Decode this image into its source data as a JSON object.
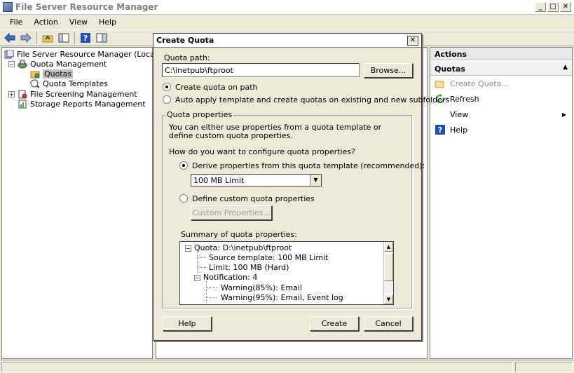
{
  "window": {
    "title": "File Server Resource Manager"
  },
  "menu": [
    "File",
    "Action",
    "View",
    "Help"
  ],
  "tree": {
    "root": "File Server Resource Manager (Local)",
    "quota_management": "Quota Management",
    "quotas": "Quotas",
    "quota_templates": "Quota Templates",
    "file_screening": "File Screening Management",
    "storage_reports": "Storage Reports Management"
  },
  "actions": {
    "header": "Actions",
    "section": "Quotas",
    "items": [
      "Create Quota...",
      "Refresh",
      "View",
      "Help"
    ]
  },
  "dialog": {
    "title": "Create Quota",
    "quota_path_label": "Quota path:",
    "quota_path_value": "C:\\inetpub\\ftproot",
    "browse": "Browse...",
    "opt_create": "Create quota on path",
    "opt_auto": "Auto apply template and create quotas on existing and new subfolders",
    "group_label": "Quota properties",
    "desc": "You can either use properties from a quota template or define custom quota properties.",
    "question": "How do you want to configure quota properties?",
    "opt_derive": "Derive properties from this quota template (recommended):",
    "template_value": "100 MB Limit",
    "opt_custom": "Define custom quota properties",
    "custom_btn": "Custom Properties...",
    "summary_label": "Summary of quota properties:",
    "summary": {
      "quota": "Quota: D:\\inetpub\\ftproot",
      "source": "Source template: 100 MB Limit",
      "limit": "Limit: 100 MB (Hard)",
      "notification": "Notification: 4",
      "warn85": "Warning(85%): Email",
      "warn95": "Warning(95%): Email, Event log"
    },
    "help": "Help",
    "create": "Create",
    "cancel": "Cancel"
  }
}
